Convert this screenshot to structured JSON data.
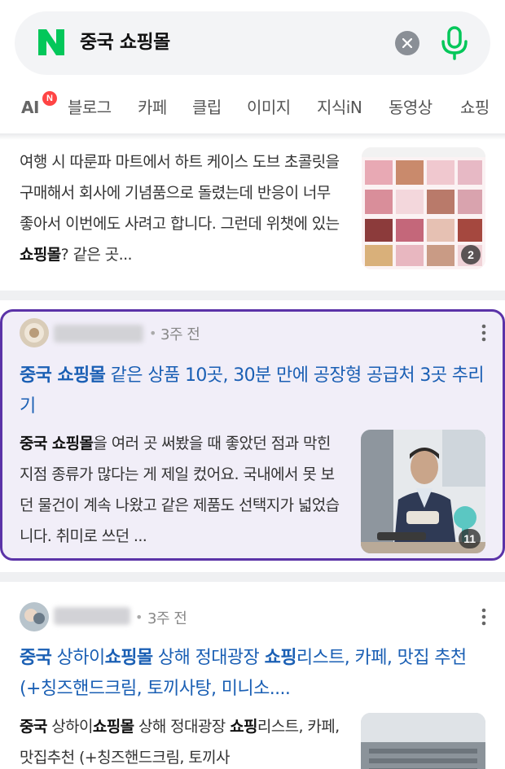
{
  "search": {
    "query": "중국 쇼핑몰",
    "logo_letter": "N",
    "brand_color": "#03c75a"
  },
  "tabs": [
    {
      "label": "AI",
      "badge": "N"
    },
    {
      "label": "블로그"
    },
    {
      "label": "카페"
    },
    {
      "label": "클립"
    },
    {
      "label": "이미지"
    },
    {
      "label": "지식iN"
    },
    {
      "label": "동영상"
    },
    {
      "label": "쇼핑"
    }
  ],
  "card1": {
    "desc_plain": "여행 시 따룬파 마트에서 하트 케이스 도브 초콜릿을 구매해서 회사에 기념품으로 돌렸는데 반응이 너무 좋아서 이번에도 사려고 합니다. 그런데 위챗에 있는 ",
    "desc_bold": "쇼핑몰",
    "desc_tail": "? 같은 곳...",
    "image_count": "2"
  },
  "card2": {
    "time": "3주 전",
    "title_bold": "중국 쇼핑몰",
    "title_rest": " 같은 상품 10곳, 30분 만에 공장형 공급처 3곳 추리기",
    "desc_bold": "중국 쇼핑몰",
    "desc_rest": "을 여러 곳 써봤을 때 좋았던 점과 막힌 지점 종류가 많다는 게 제일 컸어요. 국내에서 못 보던 물건이 계속 나왔고 같은 제품도 선택지가 넓었습니다. 취미로 쓰던 ...",
    "image_count": "11"
  },
  "card3": {
    "time": "3주 전",
    "title_parts": [
      "중국",
      " 상하이",
      "쇼핑몰",
      " 상해 정대광장 ",
      "쇼핑",
      "리스트, 카페, 맛집 추천 (+칭즈핸드크림, 토끼사탕, 미니소...."
    ],
    "desc_parts": [
      "중국",
      " 상하이",
      "쇼핑몰",
      " 상해 정대광장 ",
      "쇼핑",
      "리스트, 카페, 맛집추천 (+칭즈핸드크림, 토끼사"
    ]
  },
  "colors": {
    "link": "#1a5fb4",
    "highlight_border": "#5b33a8",
    "highlight_bg": "#f1eef8",
    "badge_red": "#ff4444"
  }
}
